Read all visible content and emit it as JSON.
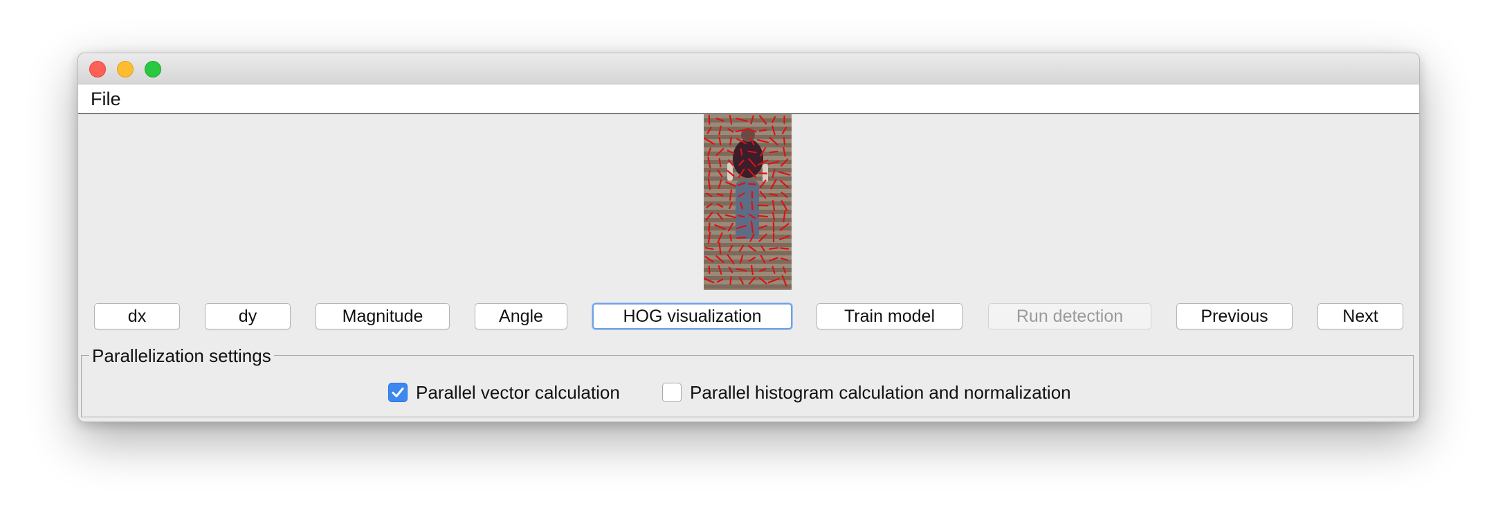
{
  "menu": {
    "file": "File"
  },
  "buttons": [
    {
      "label": "dx",
      "state": "normal"
    },
    {
      "label": "dy",
      "state": "normal"
    },
    {
      "label": "Magnitude",
      "state": "normal"
    },
    {
      "label": "Angle",
      "state": "normal"
    },
    {
      "label": "HOG visualization",
      "state": "focused"
    },
    {
      "label": "Train model",
      "state": "normal"
    },
    {
      "label": "Run detection",
      "state": "disabled"
    },
    {
      "label": "Previous",
      "state": "normal"
    },
    {
      "label": "Next",
      "state": "normal"
    }
  ],
  "parallelization": {
    "title": "Parallelization settings",
    "vector_calc": {
      "label": "Parallel vector calculation",
      "checked": true
    },
    "histogram_calc": {
      "label": "Parallel histogram calculation and normalization",
      "checked": false
    }
  },
  "colors": {
    "focus_ring": "#6ea2e6",
    "checkbox_checked": "#3d87f0",
    "hog_overlay": "#e01010"
  },
  "icons": [
    "close-window-icon",
    "minimize-window-icon",
    "maximize-window-icon",
    "checkmark-icon"
  ]
}
